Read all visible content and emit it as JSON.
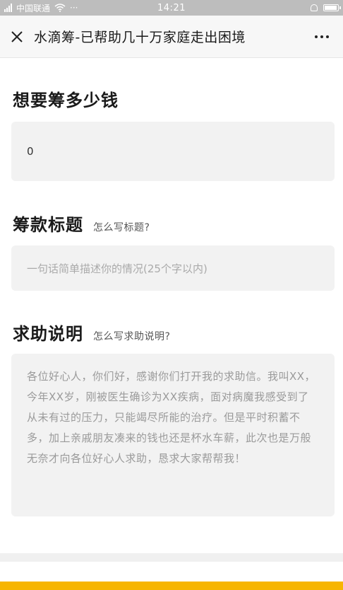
{
  "status_bar": {
    "carrier": "中国联通",
    "time": "14:21",
    "dots": "···"
  },
  "nav": {
    "title": "水滴筹-已帮助几十万家庭走出困境"
  },
  "amount_section": {
    "heading": "想要筹多少钱",
    "value": "0"
  },
  "title_section": {
    "heading": "筹款标题",
    "hint": "怎么写标题?",
    "placeholder": "一句话简单描述你的情况(25个字以内)"
  },
  "description_section": {
    "heading": "求助说明",
    "hint": "怎么写求助说明?",
    "placeholder": "各位好心人，你们好，感谢你们打开我的求助信。我叫XX，今年XX岁，刚被医生确诊为XX疾病，面对病魔我感受到了从未有过的压力，只能竭尽所能的治疗。但是平时积蓄不多，加上亲戚朋友凑来的钱也还是杯水车薪，此次也是万般无奈才向各位好心人求助，恳求大家帮帮我！"
  },
  "colors": {
    "accent": "#f7b500",
    "field_bg": "#f2f2f2",
    "status_bar_bg": "#bdbdbd"
  }
}
